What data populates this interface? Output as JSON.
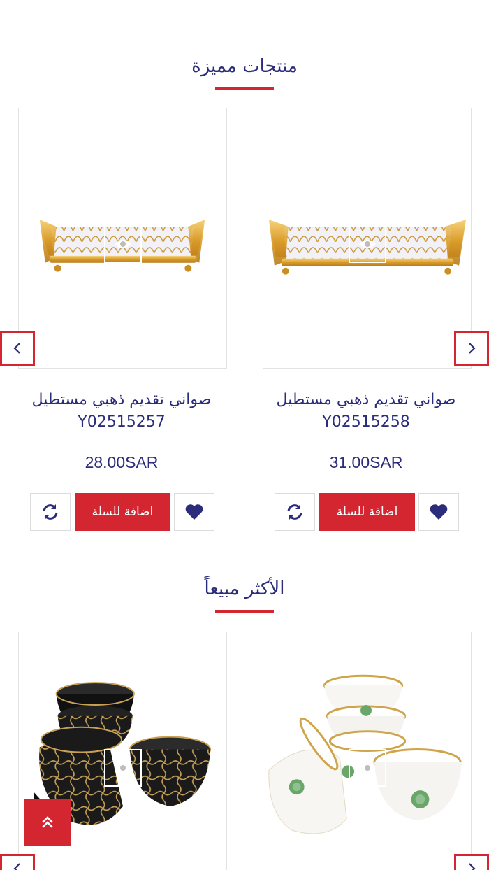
{
  "colors": {
    "accent": "#d32630",
    "text": "#2b2c7a",
    "border": "#e3e3e3"
  },
  "sections": {
    "featured": {
      "title": "منتجات مميزة",
      "products": [
        {
          "name": "صواني تقديم ذهبي مستطيل Y02515258",
          "price": "31.00SAR",
          "add_to_cart": "اضافة للسلة",
          "image": "gold-rectangular-tray"
        },
        {
          "name": "صواني تقديم ذهبي مستطيل Y02515257",
          "price": "28.00SAR",
          "add_to_cart": "اضافة للسلة",
          "image": "gold-rectangular-tray"
        }
      ]
    },
    "bestsellers": {
      "title": "الأكثر مبيعاً",
      "products": [
        {
          "image": "white-gold-coffee-cups"
        },
        {
          "image": "black-gold-coffee-cups"
        }
      ]
    }
  },
  "icons": {
    "quick_view": "eye-icon",
    "wishlist": "heart-icon",
    "compare": "refresh-icon",
    "prev": "chevron-left-icon",
    "next": "chevron-right-icon",
    "scroll_top": "double-chevron-up-icon"
  }
}
